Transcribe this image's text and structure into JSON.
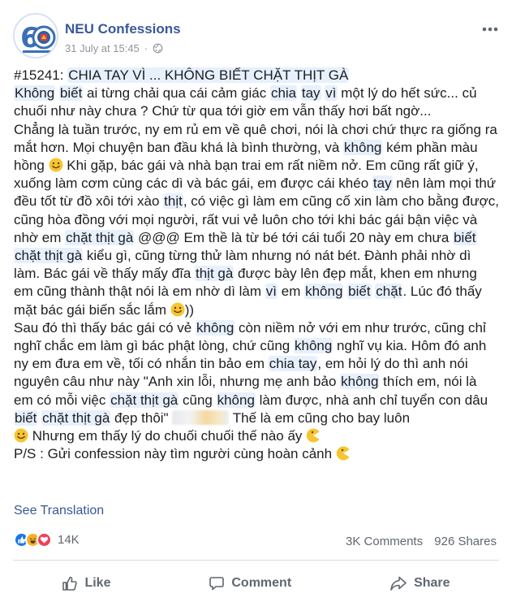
{
  "post": {
    "page_name": "NEU Confessions",
    "timestamp": "31 July at 15:45",
    "separator": "·",
    "more_icon": "more-horizontal-icon",
    "body": {
      "l1_a": "#15241: ",
      "l1_b": "CHIA TAY VÌ ... KHÔNG BIẾT CHẶT THỊT GÀ",
      "p1_a": "Không",
      "p1_b": " ",
      "p1_c": "biết",
      "p1_d": " ai từng chải qua cái cảm giác ",
      "p1_e": "chia",
      "p1_f": " ",
      "p1_g": "tay",
      "p1_h": " ",
      "p1_i": "vì",
      "p1_j": " một lý do hết sức... củ chuối như này chưa ? Chứ từ qua tới giờ em vẫn thấy hơi bất ngờ...",
      "p2_a": "Chẳng là tuần trước, ny em rủ em về quê chơi, nói là chơi chứ thực ra giống ra mắt hơn. Mọi chuyện ban đầu khá là bình thường, và ",
      "p2_b": "không",
      "p2_c": " kém phần màu hồng ",
      "p2_d": " Khi gặp, bác gái và nhà bạn trai em rất niềm nở. Em cũng rất giữ ý, xuống làm cơm cùng các dì và bác gái, em được cái khéo ",
      "p2_e": "tay",
      "p2_f": " nên làm mọi thứ đều tốt từ đồ xôi tới xào ",
      "p2_g": "thịt",
      "p2_h": ", có việc gì làm em cũng cố xin làm cho bằng được, cũng hòa đồng với mọi người, rất vui vẻ luôn cho tới khi bác gái bận việc và nhờ em ",
      "p2_i": "chặt thịt gà",
      "p2_j": " @@@ Em thề là từ bé tới cái tuổi 20 này em chưa ",
      "p2_k": "biết",
      "p2_l": " ",
      "p2_m": "chặt thịt gà",
      "p2_n": " kiểu gì, cũng từng thử làm nhưng nó nát bét. Đành phải nhờ dì làm. Bác gái về thấy mấy đĩa ",
      "p2_o": "thịt gà",
      "p2_p": " được bày lên đẹp mắt, khen em nhưng em cũng thành thật nói là em nhờ dì làm ",
      "p2_q": "vì",
      "p2_r": " em ",
      "p2_s": "không",
      "p2_t": " ",
      "p2_u": "biết",
      "p2_v": " ",
      "p2_w": "chặt",
      "p2_x": ". Lúc đó thấy mặt bác gái biến sắc lắm ",
      "p2_y": "))",
      "p3_a": "Sau đó thì thấy bác gái có vẻ ",
      "p3_b": "không",
      "p3_c": " còn niềm nở với em như trước, cũng chỉ nghĩ chắc em làm gì bác phật lòng, chứ cũng ",
      "p3_d": "không",
      "p3_e": " nghĩ vụ kia. Hôm đó anh ny em đưa em về, tối có nhắn tin bảo em ",
      "p3_f": "chia tay",
      "p3_g": ", em hỏi lý do thì anh nói nguyên câu như này \"Anh xin lỗi, nhưng mẹ anh bảo ",
      "p3_h": "không",
      "p3_i": " thích em, nói là em có mỗi việc ",
      "p3_j": "chặt thịt gà",
      "p3_k": " cũng ",
      "p3_l": "không",
      "p3_m": " làm được, nhà anh chỉ tuyển con dâu ",
      "p3_n": "biết",
      "p3_o": " ",
      "p3_p": "chặt thịt gà",
      "p3_q": " đẹp thôi\" ",
      "p3_r": " Thế là em cũng cho bay luôn",
      "p3_s": " Nhưng em thấy lý do chuối chuối thế nào ấy ",
      "ps": "P/S : Gửi confession này tìm người cùng hoàn cảnh "
    },
    "see_translation": "See Translation",
    "reactions": {
      "icons": [
        "like-react-icon",
        "haha-react-icon",
        "love-react-icon"
      ],
      "count": "14K",
      "comments": "3K Comments",
      "shares": "926 Shares"
    },
    "actions": {
      "like": "Like",
      "comment": "Comment",
      "share": "Share"
    },
    "colors": {
      "link": "#385898",
      "highlight": "#e7f0fd",
      "muted": "#606770",
      "timestamp": "#90949c"
    }
  }
}
